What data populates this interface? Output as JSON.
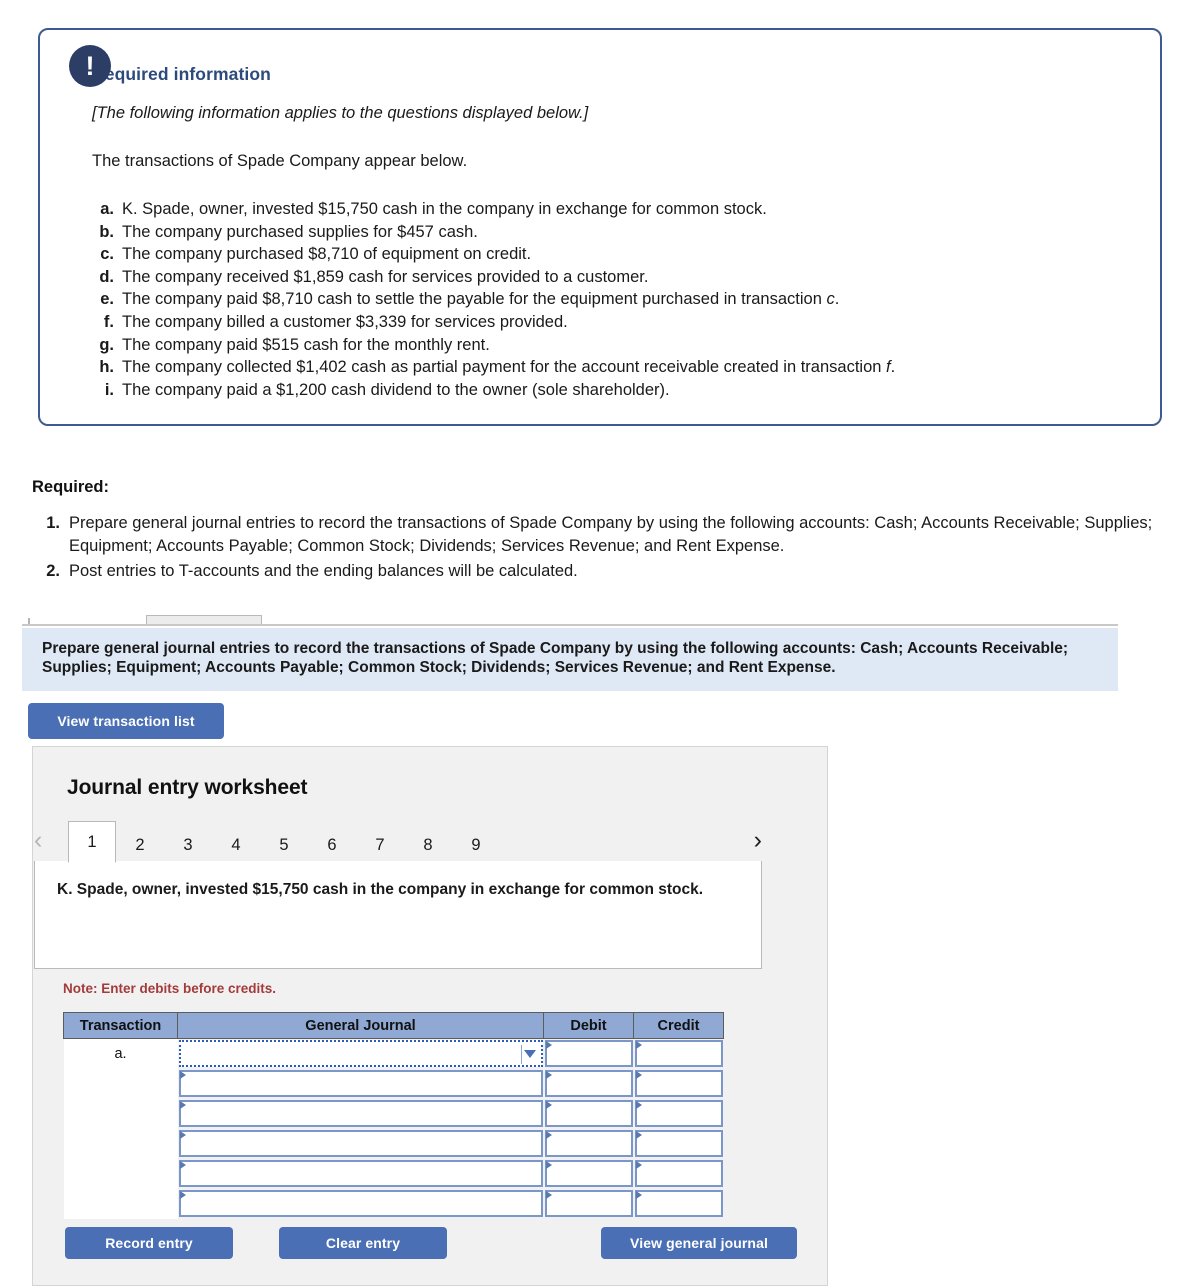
{
  "callout": {
    "icon": "exclamation-icon",
    "title": "Required information",
    "applies_note": "[The following information applies to the questions displayed below.]",
    "lead": "The transactions of Spade Company appear below.",
    "transactions": [
      {
        "letter": "a.",
        "text": "K. Spade, owner, invested $15,750 cash in the company in exchange for common stock."
      },
      {
        "letter": "b.",
        "text": "The company purchased supplies for $457 cash."
      },
      {
        "letter": "c.",
        "text": "The company purchased $8,710 of equipment on credit."
      },
      {
        "letter": "d.",
        "text": "The company received $1,859 cash for services provided to a customer."
      },
      {
        "letter": "e.",
        "text": "The company paid $8,710 cash to settle the payable for the equipment purchased in transaction c."
      },
      {
        "letter": "f.",
        "text": "The company billed a customer $3,339 for services provided."
      },
      {
        "letter": "g.",
        "text": "The company paid $515 cash for the monthly rent."
      },
      {
        "letter": "h.",
        "text": "The company collected $1,402 cash as partial payment for the account receivable created in transaction f."
      },
      {
        "letter": "i.",
        "text": "The company paid a $1,200 cash dividend to the owner (sole shareholder)."
      }
    ]
  },
  "required": {
    "heading": "Required:",
    "items": [
      {
        "num": "1.",
        "text": "Prepare general journal entries to record the transactions of Spade Company by using the following accounts: Cash; Accounts Receivable; Supplies; Equipment; Accounts Payable; Common Stock; Dividends; Services Revenue; and Rent Expense."
      },
      {
        "num": "2.",
        "text": "Post entries to T-accounts and the ending balances will be calculated."
      }
    ]
  },
  "banner": {
    "text": "Prepare general journal entries to record the transactions of Spade Company by using the following accounts: Cash; Accounts Receivable; Supplies; Equipment; Accounts Payable; Common Stock; Dividends; Services Revenue; and Rent Expense.",
    "background": "#dfe8f5"
  },
  "view_transaction_list_label": "View transaction list",
  "worksheet": {
    "title": "Journal entry worksheet",
    "prev_icon": "chevron-left-icon",
    "next_icon": "chevron-right-icon",
    "pages": [
      "1",
      "2",
      "3",
      "4",
      "5",
      "6",
      "7",
      "8",
      "9"
    ],
    "active_page": "1",
    "prompt": "K. Spade, owner, invested $15,750 cash in the company in exchange for common stock.",
    "note": "Note: Enter debits before credits.",
    "table": {
      "headers": [
        "Transaction",
        "General Journal",
        "Debit",
        "Credit"
      ],
      "rows": [
        {
          "transaction": "a.",
          "general_journal": "",
          "debit": "",
          "credit": "",
          "selected": true
        },
        {
          "transaction": "",
          "general_journal": "",
          "debit": "",
          "credit": "",
          "selected": false
        },
        {
          "transaction": "",
          "general_journal": "",
          "debit": "",
          "credit": "",
          "selected": false
        },
        {
          "transaction": "",
          "general_journal": "",
          "debit": "",
          "credit": "",
          "selected": false
        },
        {
          "transaction": "",
          "general_journal": "",
          "debit": "",
          "credit": "",
          "selected": false
        },
        {
          "transaction": "",
          "general_journal": "",
          "debit": "",
          "credit": "",
          "selected": false
        }
      ]
    },
    "buttons": {
      "record": "Record entry",
      "clear": "Clear entry",
      "view_general_journal": "View general journal"
    }
  },
  "colors": {
    "accent_blue": "#4a6fb5",
    "callout_border": "#3f5a93",
    "title_navy": "#2c4a7c",
    "note_red": "#a33b3b",
    "table_header": "#8fa9d4"
  }
}
